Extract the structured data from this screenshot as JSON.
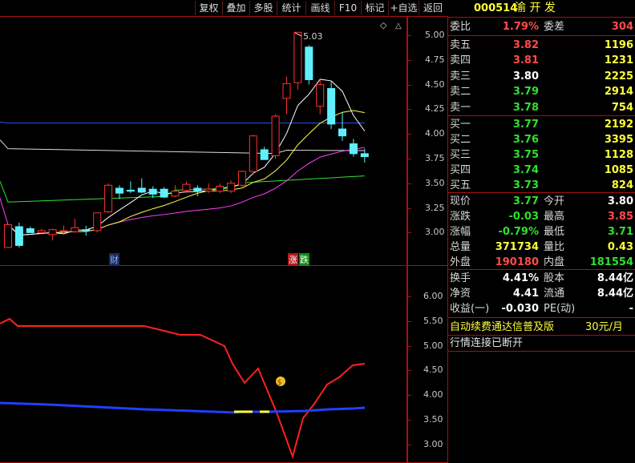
{
  "toolbar": {
    "buttons": [
      "复权",
      "叠加",
      "多股",
      "统计",
      "画线",
      "F10",
      "标记",
      "+自选",
      "返回"
    ]
  },
  "stock": {
    "code": "000514",
    "name": "渝 开 发"
  },
  "price_axis": [
    "5.00",
    "4.75",
    "4.50",
    "4.25",
    "4.00",
    "3.75",
    "3.50",
    "3.25",
    "3.00"
  ],
  "indicator_axis": [
    "6.00",
    "5.50",
    "5.00",
    "4.50",
    "4.00",
    "3.50",
    "3.00"
  ],
  "chart": {
    "peak_label": "5.03",
    "events": {
      "cai": "财",
      "zhang": "涨",
      "die": "跌"
    },
    "money_icon": "money-bag-icon",
    "candles": [
      {
        "o": 2.85,
        "h": 3.08,
        "l": 2.85,
        "c": 3.08
      },
      {
        "o": 3.06,
        "h": 3.1,
        "l": 2.85,
        "c": 2.87
      },
      {
        "o": 3.04,
        "h": 3.06,
        "l": 3.0,
        "c": 3.0
      },
      {
        "o": 3.0,
        "h": 3.04,
        "l": 2.98,
        "c": 3.02
      },
      {
        "o": 2.98,
        "h": 3.04,
        "l": 2.92,
        "c": 3.03
      },
      {
        "o": 3.02,
        "h": 3.07,
        "l": 3.0,
        "c": 3.02
      },
      {
        "o": 3.01,
        "h": 3.14,
        "l": 3.0,
        "c": 3.05
      },
      {
        "o": 3.03,
        "h": 3.07,
        "l": 2.97,
        "c": 3.02
      },
      {
        "o": 3.02,
        "h": 3.18,
        "l": 3.0,
        "c": 3.2
      },
      {
        "o": 3.21,
        "h": 3.5,
        "l": 3.2,
        "c": 3.48
      },
      {
        "o": 3.45,
        "h": 3.48,
        "l": 3.34,
        "c": 3.4
      },
      {
        "o": 3.43,
        "h": 3.52,
        "l": 3.4,
        "c": 3.42
      },
      {
        "o": 3.45,
        "h": 3.55,
        "l": 3.4,
        "c": 3.41
      },
      {
        "o": 3.44,
        "h": 3.47,
        "l": 3.35,
        "c": 3.39
      },
      {
        "o": 3.44,
        "h": 3.46,
        "l": 3.35,
        "c": 3.36
      },
      {
        "o": 3.37,
        "h": 3.48,
        "l": 3.36,
        "c": 3.42
      },
      {
        "o": 3.43,
        "h": 3.52,
        "l": 3.4,
        "c": 3.49
      },
      {
        "o": 3.45,
        "h": 3.48,
        "l": 3.37,
        "c": 3.42
      },
      {
        "o": 3.42,
        "h": 3.5,
        "l": 3.4,
        "c": 3.44
      },
      {
        "o": 3.42,
        "h": 3.5,
        "l": 3.4,
        "c": 3.47
      },
      {
        "o": 3.42,
        "h": 3.53,
        "l": 3.4,
        "c": 3.5
      },
      {
        "o": 3.48,
        "h": 3.63,
        "l": 3.45,
        "c": 3.62
      },
      {
        "o": 3.62,
        "h": 3.99,
        "l": 3.6,
        "c": 3.98
      },
      {
        "o": 3.84,
        "h": 3.87,
        "l": 3.74,
        "c": 3.74
      },
      {
        "o": 3.78,
        "h": 4.2,
        "l": 3.75,
        "c": 4.18
      },
      {
        "o": 4.36,
        "h": 4.58,
        "l": 4.2,
        "c": 4.51
      },
      {
        "o": 4.52,
        "h": 5.03,
        "l": 4.45,
        "c": 5.03
      },
      {
        "o": 4.88,
        "h": 4.9,
        "l": 4.5,
        "c": 4.55
      },
      {
        "o": 4.28,
        "h": 4.55,
        "l": 4.2,
        "c": 4.5
      },
      {
        "o": 4.46,
        "h": 4.54,
        "l": 4.05,
        "c": 4.1
      },
      {
        "o": 4.05,
        "h": 4.22,
        "l": 3.93,
        "c": 3.98
      },
      {
        "o": 3.9,
        "h": 3.95,
        "l": 3.77,
        "c": 3.8
      },
      {
        "o": 3.8,
        "h": 3.85,
        "l": 3.71,
        "c": 3.77
      }
    ],
    "colors": {
      "up": "#ff3232",
      "down": "#5ff0ff",
      "ma1": "#ffffff",
      "ma2": "#ffff4a",
      "ma3": "#ff40ff",
      "ma4": "#30e030",
      "ma5": "#dcdcdc",
      "blue": "#3050ff"
    }
  },
  "quote": {
    "header": {
      "wb_label": "委比",
      "wb_value": "1.79%",
      "wc_label": "委差",
      "wc_value": "304"
    },
    "asks": [
      {
        "label": "卖五",
        "price": "3.82",
        "vol": "1196"
      },
      {
        "label": "卖四",
        "price": "3.81",
        "vol": "1231"
      },
      {
        "label": "卖三",
        "price": "3.80",
        "vol": "2225"
      },
      {
        "label": "卖二",
        "price": "3.79",
        "vol": "2914"
      },
      {
        "label": "卖一",
        "price": "3.78",
        "vol": "754"
      }
    ],
    "bids": [
      {
        "label": "买一",
        "price": "3.77",
        "vol": "2192"
      },
      {
        "label": "买二",
        "price": "3.76",
        "vol": "3395"
      },
      {
        "label": "买三",
        "price": "3.75",
        "vol": "1128"
      },
      {
        "label": "买四",
        "price": "3.74",
        "vol": "1085"
      },
      {
        "label": "买五",
        "price": "3.73",
        "vol": "824"
      }
    ],
    "stats": [
      {
        "l1": "现价",
        "v1": "3.77",
        "l2": "今开",
        "v2": "3.80"
      },
      {
        "l1": "涨跌",
        "v1": "-0.03",
        "l2": "最高",
        "v2": "3.85"
      },
      {
        "l1": "涨幅",
        "v1": "-0.79%",
        "l2": "最低",
        "v2": "3.71"
      },
      {
        "l1": "总量",
        "v1": "371734",
        "l2": "量比",
        "v2": "0.43"
      },
      {
        "l1": "外盘",
        "v1": "190180",
        "l2": "内盘",
        "v2": "181554"
      }
    ],
    "fund": [
      {
        "l1": "换手",
        "v1": "4.41%",
        "l2": "股本",
        "v2": "8.44亿"
      },
      {
        "l1": "净资",
        "v1": "4.41",
        "l2": "流通",
        "v2": "8.44亿"
      },
      {
        "l1": "收益(一)",
        "v1": "-0.030",
        "l2": "PE(动)",
        "v2": "-"
      }
    ],
    "promo": {
      "text": "自动续费通达信普及版",
      "price": "30元/月"
    },
    "status": "行情连接已断开"
  }
}
